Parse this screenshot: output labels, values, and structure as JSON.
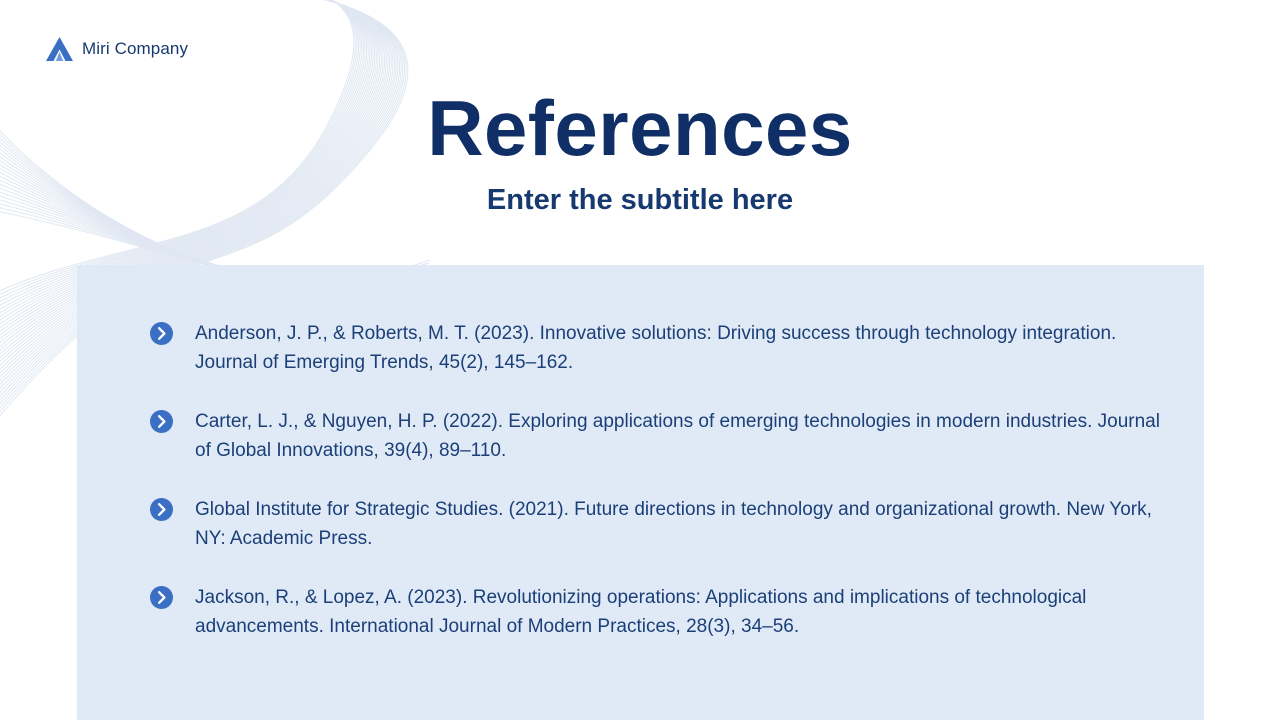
{
  "brand": {
    "name": "Miri Company",
    "logo_icon": "triangle-logo-icon",
    "color": "#3a6fc4"
  },
  "slide": {
    "title": "References",
    "subtitle": "Enter the subtitle here"
  },
  "references": [
    {
      "icon": "chevron-right-circle-icon",
      "text": "Anderson, J. P., & Roberts, M. T. (2023). Innovative solutions: Driving success through technology integration. Journal of Emerging Trends, 45(2), 145–162."
    },
    {
      "icon": "chevron-right-circle-icon",
      "text": "Carter, L. J., & Nguyen, H. P. (2022). Exploring applications of emerging technologies in modern industries. Journal of Global Innovations, 39(4), 89–110."
    },
    {
      "icon": "chevron-right-circle-icon",
      "text": "Global Institute for Strategic Studies. (2021). Future directions in technology and organizational growth. New York, NY: Academic Press."
    },
    {
      "icon": "chevron-right-circle-icon",
      "text": "Jackson, R., & Lopez, A. (2023). Revolutionizing operations: Applications and implications of technological advancements. International Journal of Modern Practices, 28(3), 34–56."
    }
  ],
  "colors": {
    "title": "#0f2f66",
    "text": "#1b3f78",
    "accent": "#3a6fc4",
    "panel": "#dee8f5"
  }
}
